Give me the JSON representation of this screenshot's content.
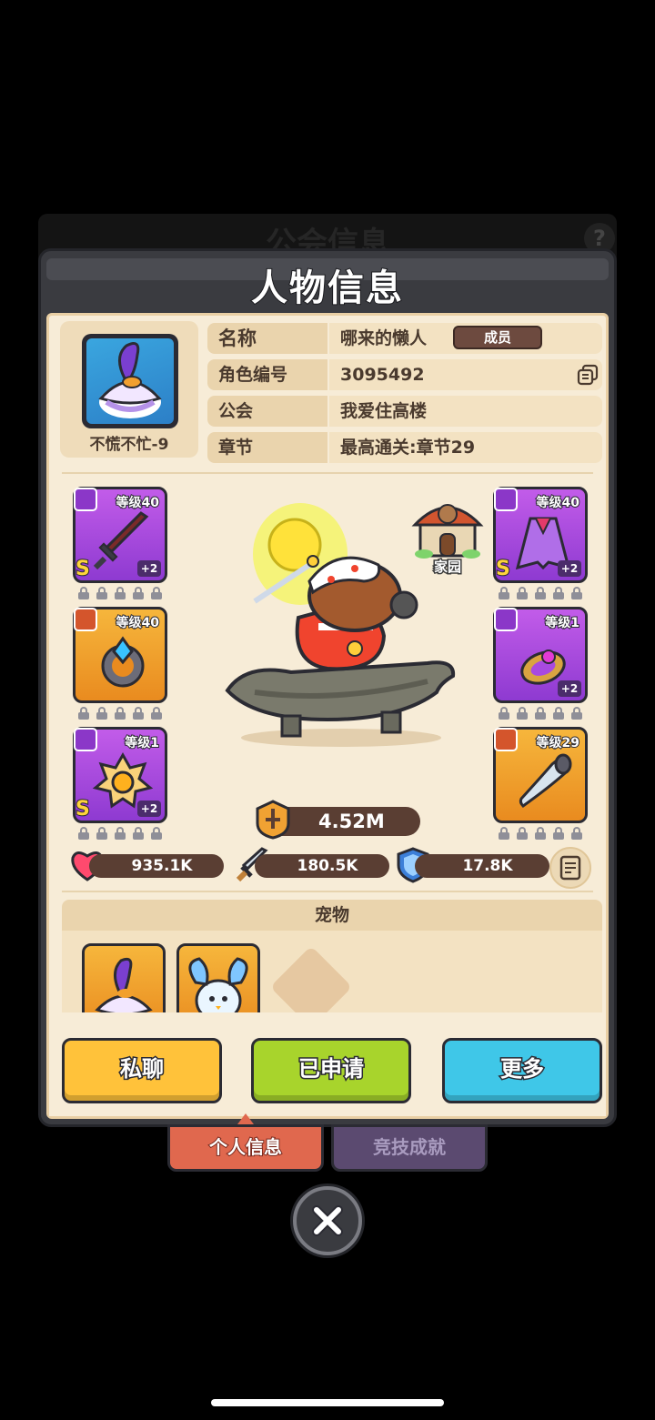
{
  "backdrop": {
    "title": "公会信息"
  },
  "dialog": {
    "title": "人物信息"
  },
  "profile": {
    "avatar_name": "不慌不忙-9",
    "rows": [
      {
        "label": "名称",
        "value": "哪来的懒人",
        "badge": "成员"
      },
      {
        "label": "角色编号",
        "value": "3095492"
      },
      {
        "label": "公会",
        "value": "我爱住高楼"
      },
      {
        "label": "章节",
        "value": "最高通关:章节29"
      }
    ]
  },
  "equipment": {
    "left": [
      {
        "slot": "weapon",
        "level": "等级40",
        "rank": "S",
        "plus": "+2",
        "color": "purple"
      },
      {
        "slot": "ring",
        "level": "等级40",
        "rank": "",
        "plus": "",
        "color": "orange"
      },
      {
        "slot": "necklace",
        "level": "等级1",
        "rank": "S",
        "plus": "+2",
        "color": "purple"
      }
    ],
    "right": [
      {
        "slot": "armor",
        "level": "等级40",
        "rank": "S",
        "plus": "+2",
        "color": "purple"
      },
      {
        "slot": "bracelet",
        "level": "等级1",
        "rank": "",
        "plus": "+2",
        "color": "purple"
      },
      {
        "slot": "horn",
        "level": "等级29",
        "rank": "",
        "plus": "",
        "color": "orange"
      }
    ]
  },
  "home_label": "家园",
  "power": "4.52M",
  "stats": {
    "hp": "935.1K",
    "attack": "180.5K",
    "defense": "17.8K"
  },
  "pets": {
    "header": "宠物"
  },
  "actions": {
    "chat": "私聊",
    "applied": "已申请",
    "more": "更多"
  },
  "tabs": {
    "personal": "个人信息",
    "arena": "竞技成就"
  },
  "colors": {
    "panel": "#3a3b40",
    "body": "#f7ecd7",
    "purple": "#a84ae0",
    "orange": "#f2a02e",
    "chat": "#ffc23a",
    "applied": "#a8d42c",
    "more": "#3fc7e8"
  }
}
